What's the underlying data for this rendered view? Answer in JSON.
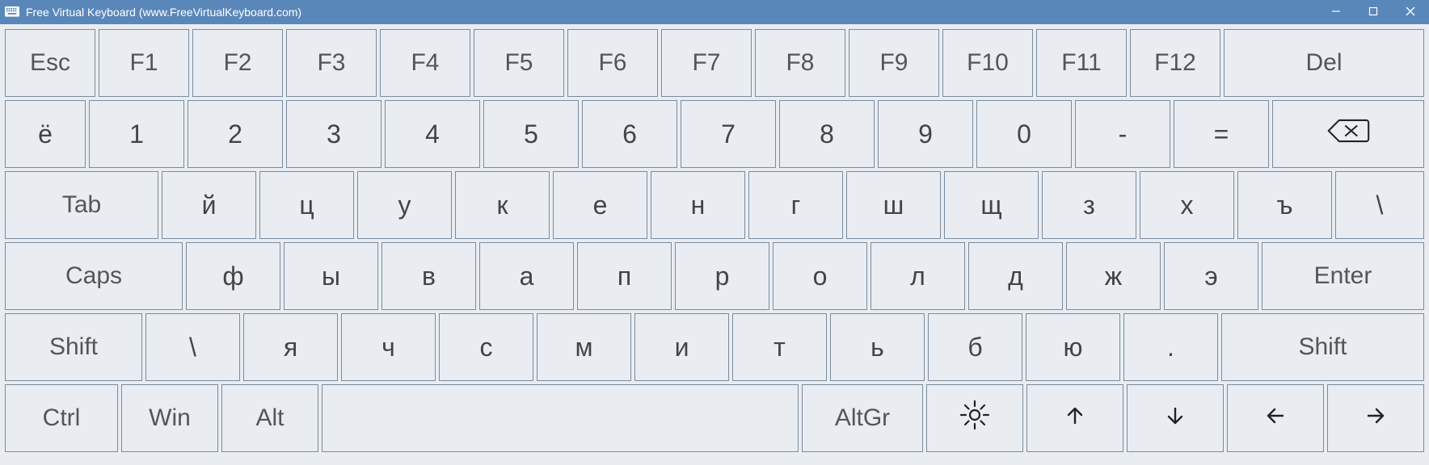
{
  "window": {
    "title": "Free Virtual Keyboard (www.FreeVirtualKeyboard.com)"
  },
  "colors": {
    "titlebar": "#5a87b9",
    "key_bg": "#e9edf2",
    "key_border": "#7a8b9c"
  },
  "rows": {
    "r0": {
      "esc": "Esc",
      "f1": "F1",
      "f2": "F2",
      "f3": "F3",
      "f4": "F4",
      "f5": "F5",
      "f6": "F6",
      "f7": "F7",
      "f8": "F8",
      "f9": "F9",
      "f10": "F10",
      "f11": "F11",
      "f12": "F12",
      "del": "Del"
    },
    "r1": {
      "yo": "ё",
      "n1": "1",
      "n2": "2",
      "n3": "3",
      "n4": "4",
      "n5": "5",
      "n6": "6",
      "n7": "7",
      "n8": "8",
      "n9": "9",
      "n0": "0",
      "minus": "-",
      "equals": "=",
      "backspace_icon": "backspace-icon"
    },
    "r2": {
      "tab": "Tab",
      "q": "й",
      "w": "ц",
      "e": "у",
      "r": "к",
      "t": "е",
      "y": "н",
      "u": "г",
      "i": "ш",
      "o": "щ",
      "p": "з",
      "br1": "х",
      "br2": "ъ",
      "bslash": "\\"
    },
    "r3": {
      "caps": "Caps",
      "a": "ф",
      "s": "ы",
      "d": "в",
      "f": "а",
      "g": "п",
      "h": "р",
      "j": "о",
      "k": "л",
      "l": "д",
      "semi": "ж",
      "quote": "э",
      "enter": "Enter"
    },
    "r4": {
      "lshift": "Shift",
      "iso": "\\",
      "z": "я",
      "x": "ч",
      "c": "с",
      "v": "м",
      "b": "и",
      "n": "т",
      "m": "ь",
      "comma": "б",
      "period": "ю",
      "slash": ".",
      "rshift": "Shift"
    },
    "r5": {
      "ctrl": "Ctrl",
      "win": "Win",
      "alt": "Alt",
      "space": "",
      "altgr": "AltGr",
      "settings_icon": "gear-icon",
      "up_icon": "arrow-up-icon",
      "down_icon": "arrow-down-icon",
      "left_icon": "arrow-left-icon",
      "right_icon": "arrow-right-icon"
    }
  }
}
